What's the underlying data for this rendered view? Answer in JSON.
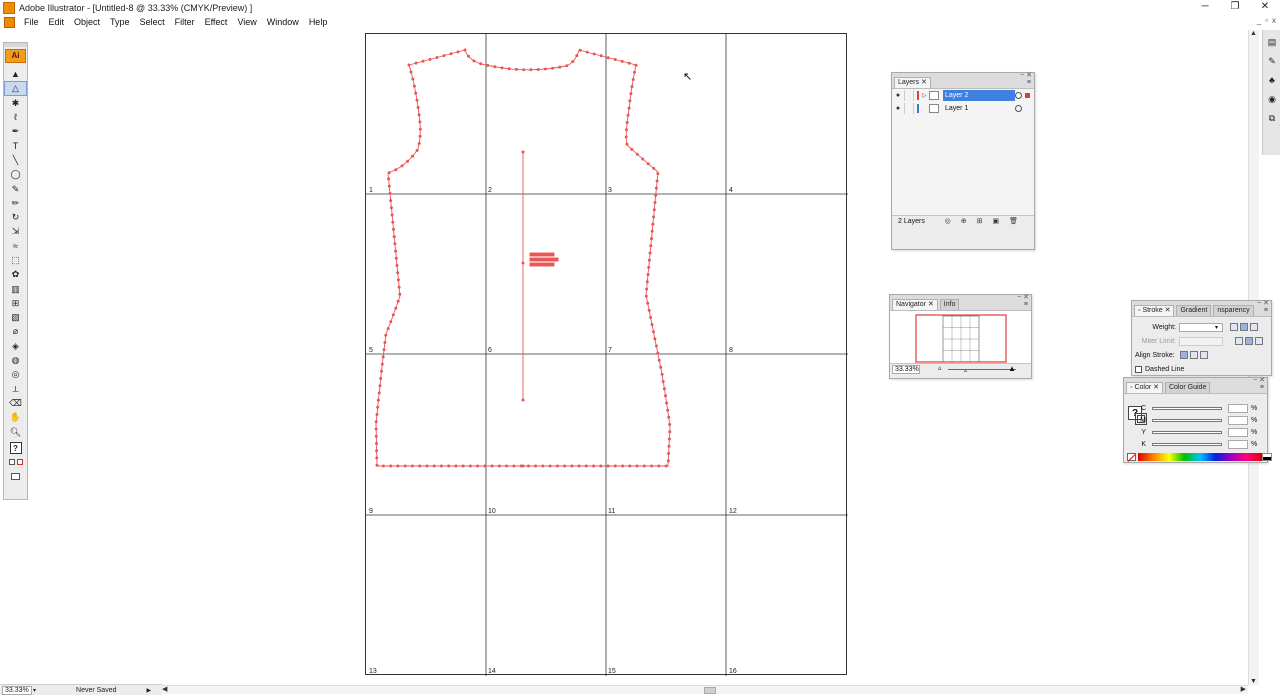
{
  "window": {
    "title": "Adobe Illustrator - [Untitled-8 @ 33.33% (CMYK/Preview) ]",
    "minimize": "─",
    "restore": "❐",
    "close": "✕"
  },
  "menubar": {
    "items": [
      "File",
      "Edit",
      "Object",
      "Type",
      "Select",
      "Filter",
      "Effect",
      "View",
      "Window",
      "Help"
    ],
    "doc_controls": [
      "_",
      "▫",
      "x"
    ]
  },
  "toolbox": {
    "badge": "Ai",
    "tools": [
      {
        "name": "selection-tool",
        "glyph": "▲",
        "active": false
      },
      {
        "name": "direct-selection-tool",
        "glyph": "△",
        "active": true
      },
      {
        "name": "magic-wand-tool",
        "glyph": "✱",
        "active": false
      },
      {
        "name": "lasso-tool",
        "glyph": "ℓ",
        "active": false
      },
      {
        "name": "pen-tool",
        "glyph": "✒",
        "active": false
      },
      {
        "name": "type-tool",
        "glyph": "T",
        "active": false
      },
      {
        "name": "line-tool",
        "glyph": "╲",
        "active": false
      },
      {
        "name": "ellipse-tool",
        "glyph": "◯",
        "active": false
      },
      {
        "name": "paintbrush-tool",
        "glyph": "✎",
        "active": false
      },
      {
        "name": "pencil-tool",
        "glyph": "✏",
        "active": false
      },
      {
        "name": "rotate-tool",
        "glyph": "↻",
        "active": false
      },
      {
        "name": "scale-tool",
        "glyph": "⇲",
        "active": false
      },
      {
        "name": "warp-tool",
        "glyph": "≈",
        "active": false
      },
      {
        "name": "free-transform-tool",
        "glyph": "⬚",
        "active": false
      },
      {
        "name": "symbol-sprayer-tool",
        "glyph": "✿",
        "active": false
      },
      {
        "name": "column-graph-tool",
        "glyph": "▥",
        "active": false
      },
      {
        "name": "mesh-tool",
        "glyph": "⊞",
        "active": false
      },
      {
        "name": "gradient-tool",
        "glyph": "▧",
        "active": false
      },
      {
        "name": "eyedropper-tool",
        "glyph": "⌀",
        "active": false
      },
      {
        "name": "blend-tool",
        "glyph": "◈",
        "active": false
      },
      {
        "name": "live-paint-tool",
        "glyph": "◍",
        "active": false
      },
      {
        "name": "live-paint-selection-tool",
        "glyph": "◎",
        "active": false
      },
      {
        "name": "slice-tool",
        "glyph": "⟂",
        "active": false
      },
      {
        "name": "eraser-tool",
        "glyph": "⌫",
        "active": false
      },
      {
        "name": "hand-tool",
        "glyph": "✋",
        "active": false
      },
      {
        "name": "zoom-tool",
        "glyph": "🔍︎",
        "active": false
      }
    ],
    "fill_stroke_glyph": "?"
  },
  "artboard": {
    "tile_numbers": [
      "1",
      "2",
      "3",
      "4",
      "5",
      "6",
      "7",
      "8",
      "9",
      "10",
      "11",
      "12",
      "13",
      "14",
      "15",
      "16"
    ]
  },
  "colors": {
    "path_red": "#e85656",
    "selection_blue": "#3d80e0",
    "layer2_color": "#e23b3b",
    "layer1_color": "#4a6fd6"
  },
  "status": {
    "zoom": "33.33%",
    "info": "Never Saved"
  },
  "layers_panel": {
    "tab": "Layers",
    "layers": [
      {
        "name": "Layer 2",
        "selected": true
      },
      {
        "name": "Layer 1",
        "selected": false
      }
    ],
    "count": "2 Layers"
  },
  "navigator_panel": {
    "tabs": [
      "Navigator",
      "Info"
    ],
    "zoom": "33.33%"
  },
  "stroke_panel": {
    "tabs": [
      "Stroke",
      "Gradient",
      "nsparency"
    ],
    "weight_label": "Weight:",
    "miter_label": "Miter Limit:",
    "align_label": "Align Stroke:",
    "dashed_label": "Dashed Line"
  },
  "color_panel": {
    "tabs": [
      "Color",
      "Color Guide"
    ],
    "channels": [
      "C",
      "M",
      "Y",
      "K"
    ],
    "percent": "%",
    "fill_glyph": "?"
  }
}
